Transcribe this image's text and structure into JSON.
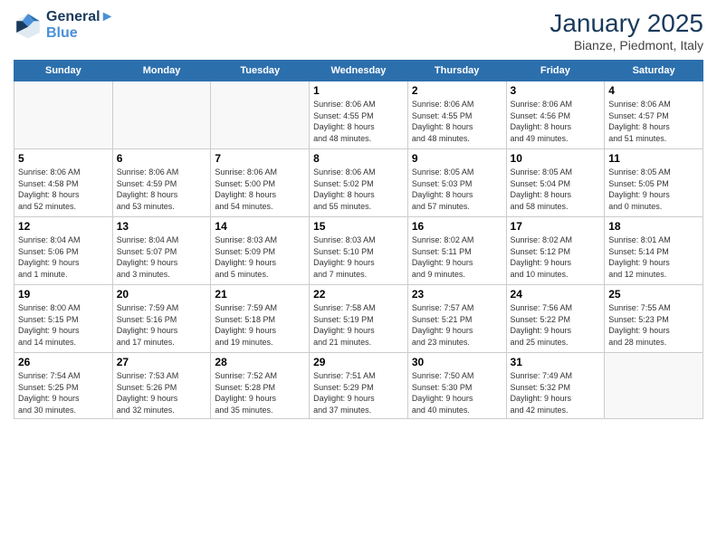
{
  "header": {
    "logo_line1": "General",
    "logo_line2": "Blue",
    "month_title": "January 2025",
    "subtitle": "Bianze, Piedmont, Italy"
  },
  "weekdays": [
    "Sunday",
    "Monday",
    "Tuesday",
    "Wednesday",
    "Thursday",
    "Friday",
    "Saturday"
  ],
  "weeks": [
    [
      {
        "day": "",
        "info": ""
      },
      {
        "day": "",
        "info": ""
      },
      {
        "day": "",
        "info": ""
      },
      {
        "day": "1",
        "info": "Sunrise: 8:06 AM\nSunset: 4:55 PM\nDaylight: 8 hours\nand 48 minutes."
      },
      {
        "day": "2",
        "info": "Sunrise: 8:06 AM\nSunset: 4:55 PM\nDaylight: 8 hours\nand 48 minutes."
      },
      {
        "day": "3",
        "info": "Sunrise: 8:06 AM\nSunset: 4:56 PM\nDaylight: 8 hours\nand 49 minutes."
      },
      {
        "day": "4",
        "info": "Sunrise: 8:06 AM\nSunset: 4:57 PM\nDaylight: 8 hours\nand 51 minutes."
      }
    ],
    [
      {
        "day": "5",
        "info": "Sunrise: 8:06 AM\nSunset: 4:58 PM\nDaylight: 8 hours\nand 52 minutes."
      },
      {
        "day": "6",
        "info": "Sunrise: 8:06 AM\nSunset: 4:59 PM\nDaylight: 8 hours\nand 53 minutes."
      },
      {
        "day": "7",
        "info": "Sunrise: 8:06 AM\nSunset: 5:00 PM\nDaylight: 8 hours\nand 54 minutes."
      },
      {
        "day": "8",
        "info": "Sunrise: 8:06 AM\nSunset: 5:02 PM\nDaylight: 8 hours\nand 55 minutes."
      },
      {
        "day": "9",
        "info": "Sunrise: 8:05 AM\nSunset: 5:03 PM\nDaylight: 8 hours\nand 57 minutes."
      },
      {
        "day": "10",
        "info": "Sunrise: 8:05 AM\nSunset: 5:04 PM\nDaylight: 8 hours\nand 58 minutes."
      },
      {
        "day": "11",
        "info": "Sunrise: 8:05 AM\nSunset: 5:05 PM\nDaylight: 9 hours\nand 0 minutes."
      }
    ],
    [
      {
        "day": "12",
        "info": "Sunrise: 8:04 AM\nSunset: 5:06 PM\nDaylight: 9 hours\nand 1 minute."
      },
      {
        "day": "13",
        "info": "Sunrise: 8:04 AM\nSunset: 5:07 PM\nDaylight: 9 hours\nand 3 minutes."
      },
      {
        "day": "14",
        "info": "Sunrise: 8:03 AM\nSunset: 5:09 PM\nDaylight: 9 hours\nand 5 minutes."
      },
      {
        "day": "15",
        "info": "Sunrise: 8:03 AM\nSunset: 5:10 PM\nDaylight: 9 hours\nand 7 minutes."
      },
      {
        "day": "16",
        "info": "Sunrise: 8:02 AM\nSunset: 5:11 PM\nDaylight: 9 hours\nand 9 minutes."
      },
      {
        "day": "17",
        "info": "Sunrise: 8:02 AM\nSunset: 5:12 PM\nDaylight: 9 hours\nand 10 minutes."
      },
      {
        "day": "18",
        "info": "Sunrise: 8:01 AM\nSunset: 5:14 PM\nDaylight: 9 hours\nand 12 minutes."
      }
    ],
    [
      {
        "day": "19",
        "info": "Sunrise: 8:00 AM\nSunset: 5:15 PM\nDaylight: 9 hours\nand 14 minutes."
      },
      {
        "day": "20",
        "info": "Sunrise: 7:59 AM\nSunset: 5:16 PM\nDaylight: 9 hours\nand 17 minutes."
      },
      {
        "day": "21",
        "info": "Sunrise: 7:59 AM\nSunset: 5:18 PM\nDaylight: 9 hours\nand 19 minutes."
      },
      {
        "day": "22",
        "info": "Sunrise: 7:58 AM\nSunset: 5:19 PM\nDaylight: 9 hours\nand 21 minutes."
      },
      {
        "day": "23",
        "info": "Sunrise: 7:57 AM\nSunset: 5:21 PM\nDaylight: 9 hours\nand 23 minutes."
      },
      {
        "day": "24",
        "info": "Sunrise: 7:56 AM\nSunset: 5:22 PM\nDaylight: 9 hours\nand 25 minutes."
      },
      {
        "day": "25",
        "info": "Sunrise: 7:55 AM\nSunset: 5:23 PM\nDaylight: 9 hours\nand 28 minutes."
      }
    ],
    [
      {
        "day": "26",
        "info": "Sunrise: 7:54 AM\nSunset: 5:25 PM\nDaylight: 9 hours\nand 30 minutes."
      },
      {
        "day": "27",
        "info": "Sunrise: 7:53 AM\nSunset: 5:26 PM\nDaylight: 9 hours\nand 32 minutes."
      },
      {
        "day": "28",
        "info": "Sunrise: 7:52 AM\nSunset: 5:28 PM\nDaylight: 9 hours\nand 35 minutes."
      },
      {
        "day": "29",
        "info": "Sunrise: 7:51 AM\nSunset: 5:29 PM\nDaylight: 9 hours\nand 37 minutes."
      },
      {
        "day": "30",
        "info": "Sunrise: 7:50 AM\nSunset: 5:30 PM\nDaylight: 9 hours\nand 40 minutes."
      },
      {
        "day": "31",
        "info": "Sunrise: 7:49 AM\nSunset: 5:32 PM\nDaylight: 9 hours\nand 42 minutes."
      },
      {
        "day": "",
        "info": ""
      }
    ]
  ]
}
